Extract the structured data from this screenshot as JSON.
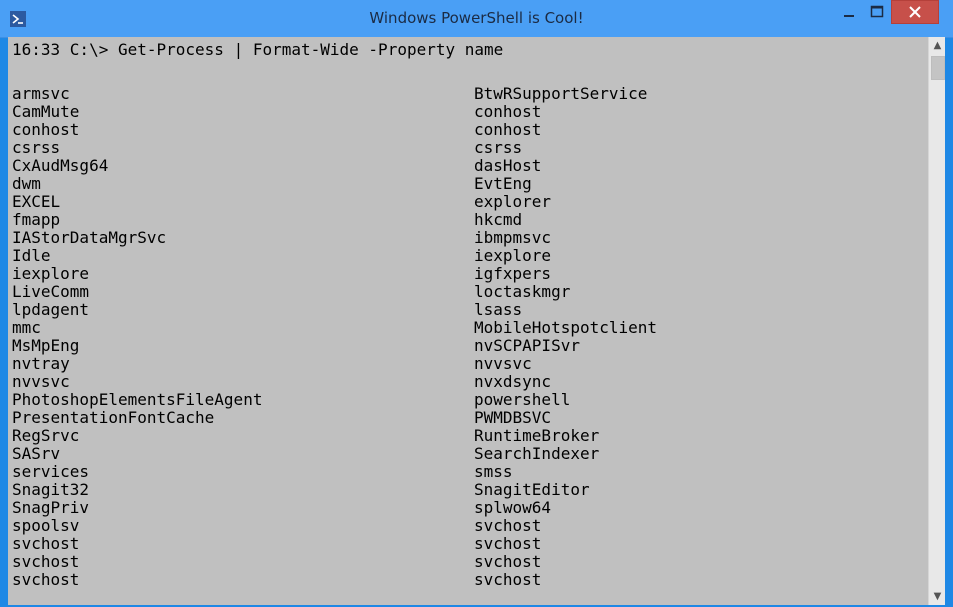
{
  "window": {
    "title": "Windows PowerShell is Cool!",
    "controls": {
      "minimize_icon": "minimize-icon",
      "maximize_icon": "maximize-icon",
      "close_icon": "close-icon"
    }
  },
  "console": {
    "prompt": "16:33 C:\\> ",
    "command": "Get-Process | Format-Wide -Property name",
    "rows": [
      [
        "armsvc",
        "BtwRSupportService"
      ],
      [
        "CamMute",
        "conhost"
      ],
      [
        "conhost",
        "conhost"
      ],
      [
        "csrss",
        "csrss"
      ],
      [
        "CxAudMsg64",
        "dasHost"
      ],
      [
        "dwm",
        "EvtEng"
      ],
      [
        "EXCEL",
        "explorer"
      ],
      [
        "fmapp",
        "hkcmd"
      ],
      [
        "IAStorDataMgrSvc",
        "ibmpmsvc"
      ],
      [
        "Idle",
        "iexplore"
      ],
      [
        "iexplore",
        "igfxpers"
      ],
      [
        "LiveComm",
        "loctaskmgr"
      ],
      [
        "lpdagent",
        "lsass"
      ],
      [
        "mmc",
        "MobileHotspotclient"
      ],
      [
        "MsMpEng",
        "nvSCPAPISvr"
      ],
      [
        "nvtray",
        "nvvsvc"
      ],
      [
        "nvvsvc",
        "nvxdsync"
      ],
      [
        "PhotoshopElementsFileAgent",
        "powershell"
      ],
      [
        "PresentationFontCache",
        "PWMDBSVC"
      ],
      [
        "RegSrvc",
        "RuntimeBroker"
      ],
      [
        "SASrv",
        "SearchIndexer"
      ],
      [
        "services",
        "smss"
      ],
      [
        "Snagit32",
        "SnagitEditor"
      ],
      [
        "SnagPriv",
        "splwow64"
      ],
      [
        "spoolsv",
        "svchost"
      ],
      [
        "svchost",
        "svchost"
      ],
      [
        "svchost",
        "svchost"
      ],
      [
        "svchost",
        "svchost"
      ]
    ]
  },
  "colors": {
    "title_bar": "#4a9ff5",
    "console_background": "#c0c0c0",
    "close_button": "#c7504a"
  }
}
